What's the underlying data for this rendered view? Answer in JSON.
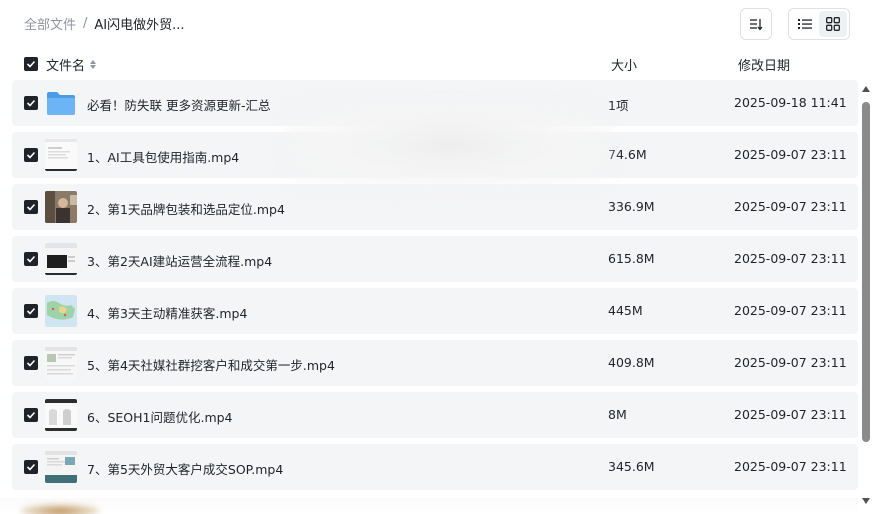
{
  "breadcrumb": {
    "root": "全部文件",
    "separator": "/",
    "current": "AI闪电做外贸..."
  },
  "toolbar": {
    "sort_icon": "sort-icon",
    "list_view_icon": "list-view-icon",
    "grid_view_icon": "grid-view-icon",
    "active_view": "list"
  },
  "columns": {
    "name": "文件名",
    "size": "大小",
    "modified": "修改日期"
  },
  "files": [
    {
      "name": "必看！防失联 更多资源更新-汇总",
      "size": "1项",
      "modified": "2025-09-18 11:41",
      "type": "folder"
    },
    {
      "name": "1、AI工具包使用指南.mp4",
      "size": "74.6M",
      "modified": "2025-09-07 23:11",
      "type": "video"
    },
    {
      "name": "2、第1天品牌包装和选品定位.mp4",
      "size": "336.9M",
      "modified": "2025-09-07 23:11",
      "type": "video"
    },
    {
      "name": "3、第2天AI建站运营全流程.mp4",
      "size": "615.8M",
      "modified": "2025-09-07 23:11",
      "type": "video"
    },
    {
      "name": "4、第3天主动精准获客.mp4",
      "size": "445M",
      "modified": "2025-09-07 23:11",
      "type": "video"
    },
    {
      "name": "5、第4天社媒社群挖客户和成交第一步.mp4",
      "size": "409.8M",
      "modified": "2025-09-07 23:11",
      "type": "video"
    },
    {
      "name": "6、SEOH1问题优化.mp4",
      "size": "8M",
      "modified": "2025-09-07 23:11",
      "type": "video"
    },
    {
      "name": "7、第5天外贸大客户成交SOP.mp4",
      "size": "345.6M",
      "modified": "2025-09-07 23:11",
      "type": "video"
    }
  ],
  "colors": {
    "row_bg": "#f4f5f6",
    "checkbox": "#1f2329",
    "folder": "#5aa8f0",
    "muted_text": "#8f959e"
  }
}
